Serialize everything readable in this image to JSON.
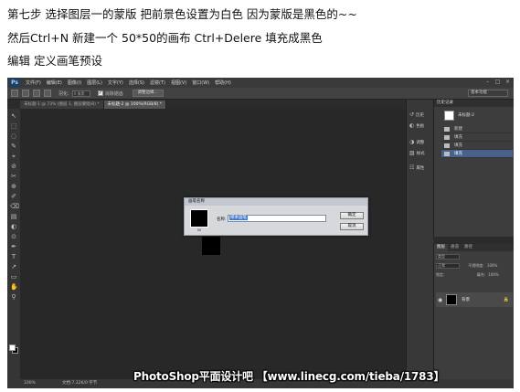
{
  "instructions": {
    "line1": "第七步 选择图层一的蒙版 把前景色设置为白色 因为蒙版是黑色的~~",
    "line2": "然后Ctrl+N 新建一个 50*50的画布 Ctrl+Delere 填充成黑色",
    "line3": "编辑 定义画笔预设"
  },
  "app": {
    "logo": "Ps",
    "menus": [
      "文件(F)",
      "编辑(E)",
      "图像(I)",
      "图层(L)",
      "文字(Y)",
      "选择(S)",
      "滤镜(T)",
      "视图(V)",
      "窗口(W)",
      "帮助(H)"
    ],
    "window_controls": {
      "minimize": "–",
      "maximize": "□",
      "close": "×"
    }
  },
  "options_bar": {
    "feather_label": "羽化:",
    "feather_value": "0 像素",
    "antialias_label": "消除锯齿",
    "refine_button": "调整边缘...",
    "workspace": "基本功能"
  },
  "document_tabs": [
    "未标题-1 @ 73% (图层 1, 图层蒙版/8) *",
    "未标题-2 @ 100%(RGB/8) *"
  ],
  "tools": [
    "↖",
    "⬚",
    "◌",
    "✎",
    "⌖",
    "⊘",
    "✂",
    "⊕",
    "✐",
    "⌫",
    "▤",
    "◐",
    "⊙",
    "✒",
    "T",
    "↗",
    "▭",
    "✋",
    "⚲"
  ],
  "dialog": {
    "title": "画笔名称",
    "brush_size": "50",
    "name_label": "名称:",
    "name_value": "样本画笔",
    "ok_button": "确定",
    "cancel_button": "取消"
  },
  "panel_icons": [
    {
      "icon": "↺",
      "label": "历史"
    },
    {
      "icon": "◐",
      "label": "色板"
    },
    {
      "icon": "◑",
      "label": "调整"
    },
    {
      "icon": "▧",
      "label": "样式"
    },
    {
      "icon": "☷",
      "label": "属性"
    }
  ],
  "history": {
    "title": "历史记录",
    "snapshot": "未标题-2",
    "steps": [
      {
        "label": "新建"
      },
      {
        "label": "填充"
      },
      {
        "label": "填充"
      },
      {
        "label": "填充"
      }
    ]
  },
  "layers": {
    "tabs": [
      "图层",
      "通道",
      "路径"
    ],
    "kind_label": "类型",
    "mode": "正常",
    "opacity_label": "不透明度:",
    "opacity_value": "100%",
    "lock_label": "锁定:",
    "fill_label": "填充:",
    "fill_value": "100%",
    "layer_name": "背景"
  },
  "status": {
    "zoom": "100%",
    "doc_size": "文档:7.32K/0 字节"
  },
  "watermark": "PhotoShop平面设计吧 【www.linecg.com/tieba/1783】"
}
